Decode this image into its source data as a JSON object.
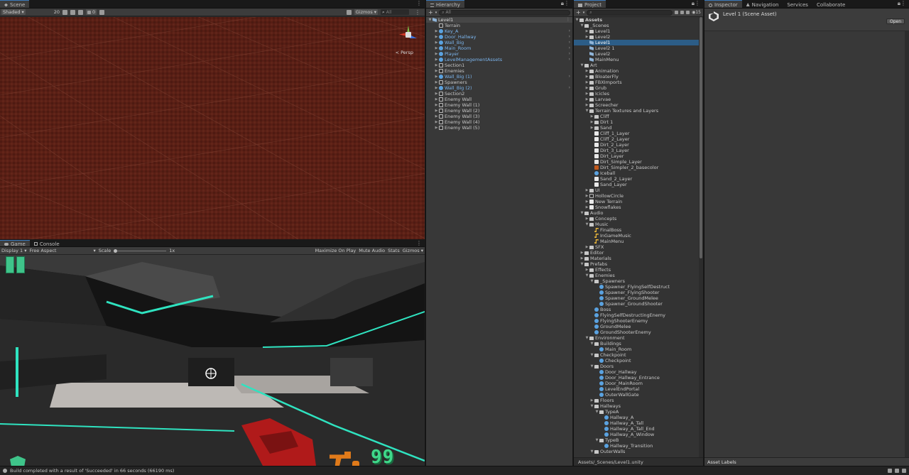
{
  "scene": {
    "tab": "Scene",
    "shading": "Shaded",
    "grid_size": "20",
    "layers_count": "0",
    "gizmos": "Gizmos",
    "search": "All",
    "persp": "< Persp"
  },
  "game": {
    "tabs": [
      "Game",
      "Console"
    ],
    "display": "Display 1",
    "aspect": "Free Aspect",
    "scale_label": "Scale",
    "scale_value": "1x",
    "maximize": "Maximize On Play",
    "mute": "Mute Audio",
    "stats": "Stats",
    "gizmos": "Gizmos",
    "ammo": "99"
  },
  "hierarchy": {
    "tab": "Hierarchy",
    "search": "All",
    "items": [
      {
        "label": "Level1",
        "depth": 0,
        "icon": "scene",
        "root": true,
        "expanded": true
      },
      {
        "label": "Terrain",
        "depth": 1,
        "icon": "cube"
      },
      {
        "label": "Key_A",
        "depth": 1,
        "icon": "prefab",
        "blue": true,
        "arrow": true,
        "chev": true
      },
      {
        "label": "Door_Hallway",
        "depth": 1,
        "icon": "prefab",
        "blue": true,
        "arrow": true,
        "chev": true
      },
      {
        "label": "Wall_Big",
        "depth": 1,
        "icon": "prefab",
        "blue": true,
        "arrow": true,
        "chev": true
      },
      {
        "label": "Main_Room",
        "depth": 1,
        "icon": "prefab",
        "blue": true,
        "arrow": true,
        "chev": true
      },
      {
        "label": "Player",
        "depth": 1,
        "icon": "prefab",
        "blue": true,
        "arrow": true,
        "chev": true
      },
      {
        "label": "LevelManagementAssets",
        "depth": 1,
        "icon": "prefab",
        "blue": true,
        "arrow": true,
        "chev": true
      },
      {
        "label": "Section1",
        "depth": 1,
        "icon": "cube",
        "arrow": true
      },
      {
        "label": "Enemies",
        "depth": 1,
        "icon": "cube",
        "arrow": true
      },
      {
        "label": "Wall_Big (1)",
        "depth": 1,
        "icon": "prefab",
        "blue": true,
        "arrow": true,
        "chev": true
      },
      {
        "label": "Spawners",
        "depth": 1,
        "icon": "cube",
        "arrow": true
      },
      {
        "label": "Wall_Big (2)",
        "depth": 1,
        "icon": "prefab",
        "blue": true,
        "arrow": true,
        "chev": true
      },
      {
        "label": "Section2",
        "depth": 1,
        "icon": "cube",
        "arrow": true
      },
      {
        "label": "Enemy Wall",
        "depth": 1,
        "icon": "cube",
        "arrow": true
      },
      {
        "label": "Enemy Wall (1)",
        "depth": 1,
        "icon": "cube",
        "arrow": true
      },
      {
        "label": "Enemy Wall (2)",
        "depth": 1,
        "icon": "cube",
        "arrow": true
      },
      {
        "label": "Enemy Wall (3)",
        "depth": 1,
        "icon": "cube",
        "arrow": true
      },
      {
        "label": "Enemy Wall (4)",
        "depth": 1,
        "icon": "cube",
        "arrow": true
      },
      {
        "label": "Enemy Wall (5)",
        "depth": 1,
        "icon": "cube",
        "arrow": true
      }
    ]
  },
  "project": {
    "tab": "Project",
    "count": "15",
    "path": "Assets/_Scenes/Level1.unity",
    "items": [
      {
        "label": "Assets",
        "depth": 0,
        "icon": "folder",
        "exp": true,
        "bold": true
      },
      {
        "label": "_Scenes",
        "depth": 1,
        "icon": "folder",
        "exp": true
      },
      {
        "label": "Level1",
        "depth": 2,
        "icon": "folder",
        "col": true
      },
      {
        "label": "Level2",
        "depth": 2,
        "icon": "folder",
        "col": true
      },
      {
        "label": "Level1",
        "depth": 2,
        "icon": "scene",
        "sel": true
      },
      {
        "label": "Level2 1",
        "depth": 2,
        "icon": "scene"
      },
      {
        "label": "Level2",
        "depth": 2,
        "icon": "scene"
      },
      {
        "label": "MainMenu",
        "depth": 2,
        "icon": "scene"
      },
      {
        "label": "Art",
        "depth": 1,
        "icon": "folder",
        "exp": true
      },
      {
        "label": "Animation",
        "depth": 2,
        "icon": "folder",
        "col": true
      },
      {
        "label": "BloaterFly",
        "depth": 2,
        "icon": "folder",
        "col": true
      },
      {
        "label": "FBXImports",
        "depth": 2,
        "icon": "folder",
        "col": true
      },
      {
        "label": "Grub",
        "depth": 2,
        "icon": "folder",
        "col": true
      },
      {
        "label": "Icicles",
        "depth": 2,
        "icon": "folder",
        "col": true
      },
      {
        "label": "Larvae",
        "depth": 2,
        "icon": "folder",
        "col": true
      },
      {
        "label": "Screecher",
        "depth": 2,
        "icon": "folder",
        "col": true
      },
      {
        "label": "Terrain Textures and Layers",
        "depth": 2,
        "icon": "folder",
        "exp": true
      },
      {
        "label": "Cliff",
        "depth": 3,
        "icon": "folder",
        "col": true
      },
      {
        "label": "Dirt 1",
        "depth": 3,
        "icon": "folder",
        "col": true
      },
      {
        "label": "Sand",
        "depth": 3,
        "icon": "folder",
        "col": true
      },
      {
        "label": "Cliff_1_Layer",
        "depth": 3,
        "icon": "tex"
      },
      {
        "label": "Cliff_2_Layer",
        "depth": 3,
        "icon": "tex"
      },
      {
        "label": "Dirt_2_Layer",
        "depth": 3,
        "icon": "tex"
      },
      {
        "label": "Dirt_3_Layer",
        "depth": 3,
        "icon": "tex"
      },
      {
        "label": "Dirt_Layer",
        "depth": 3,
        "icon": "tex"
      },
      {
        "label": "Dirt_Simple_Layer",
        "depth": 3,
        "icon": "tex"
      },
      {
        "label": "Dirt_Simpler_2_basecolor",
        "depth": 3,
        "icon": "color"
      },
      {
        "label": "Iceball",
        "depth": 3,
        "icon": "prefab"
      },
      {
        "label": "Sand_2_Layer",
        "depth": 3,
        "icon": "tex"
      },
      {
        "label": "Sand_Layer",
        "depth": 3,
        "icon": "tex"
      },
      {
        "label": "UI",
        "depth": 2,
        "icon": "folder",
        "col": true
      },
      {
        "label": "HollowCircle",
        "depth": 2,
        "icon": "cube",
        "col": true
      },
      {
        "label": "New Terrain",
        "depth": 2,
        "icon": "tex",
        "col": true
      },
      {
        "label": "Snowflakes",
        "depth": 2,
        "icon": "tex",
        "col": true
      },
      {
        "label": "Audio",
        "depth": 1,
        "icon": "folder",
        "exp": true
      },
      {
        "label": "Concepts",
        "depth": 2,
        "icon": "folder",
        "col": true
      },
      {
        "label": "Music",
        "depth": 2,
        "icon": "folder",
        "exp": true
      },
      {
        "label": "FinalBoss",
        "depth": 3,
        "icon": "music"
      },
      {
        "label": "InGameMusic",
        "depth": 3,
        "icon": "music"
      },
      {
        "label": "MainMenu",
        "depth": 3,
        "icon": "music"
      },
      {
        "label": "SFX",
        "depth": 2,
        "icon": "folder",
        "col": true
      },
      {
        "label": "Editor",
        "depth": 1,
        "icon": "folder",
        "col": true
      },
      {
        "label": "Materials",
        "depth": 1,
        "icon": "folder",
        "col": true
      },
      {
        "label": "Prefabs",
        "depth": 1,
        "icon": "folder",
        "exp": true
      },
      {
        "label": "Effects",
        "depth": 2,
        "icon": "folder",
        "col": true
      },
      {
        "label": "Enemies",
        "depth": 2,
        "icon": "folder",
        "exp": true
      },
      {
        "label": "_Spawners",
        "depth": 3,
        "icon": "folder",
        "exp": true
      },
      {
        "label": "Spawner_FlyingSelfDestruct",
        "depth": 4,
        "icon": "prefab"
      },
      {
        "label": "Spawner_FlyingShooter",
        "depth": 4,
        "icon": "prefab"
      },
      {
        "label": "Spawner_GroundMelee",
        "depth": 4,
        "icon": "prefab"
      },
      {
        "label": "Spawner_GroundShooter",
        "depth": 4,
        "icon": "prefab"
      },
      {
        "label": "Boss",
        "depth": 3,
        "icon": "prefab"
      },
      {
        "label": "FlyingSelfDestructingEnemy",
        "depth": 3,
        "icon": "prefab"
      },
      {
        "label": "FlyingShooterEnemy",
        "depth": 3,
        "icon": "prefab"
      },
      {
        "label": "GroundMelee",
        "depth": 3,
        "icon": "prefab"
      },
      {
        "label": "GroundShooterEnemy",
        "depth": 3,
        "icon": "prefab"
      },
      {
        "label": "Environment",
        "depth": 2,
        "icon": "folder",
        "exp": true
      },
      {
        "label": "Buildings",
        "depth": 3,
        "icon": "folder",
        "exp": true
      },
      {
        "label": "Main_Room",
        "depth": 4,
        "icon": "prefab"
      },
      {
        "label": "Checkpoint",
        "depth": 3,
        "icon": "folder",
        "exp": true
      },
      {
        "label": "Checkpoint",
        "depth": 4,
        "icon": "prefab"
      },
      {
        "label": "Doors",
        "depth": 3,
        "icon": "folder",
        "exp": true
      },
      {
        "label": "Door_Hallway",
        "depth": 4,
        "icon": "prefab"
      },
      {
        "label": "Door_Hallway_Entrance",
        "depth": 4,
        "icon": "prefab"
      },
      {
        "label": "Door_MainRoom",
        "depth": 4,
        "icon": "prefab"
      },
      {
        "label": "LevelEndPortal",
        "depth": 4,
        "icon": "prefab"
      },
      {
        "label": "OuterWallGate",
        "depth": 4,
        "icon": "prefab"
      },
      {
        "label": "Floors",
        "depth": 3,
        "icon": "folder",
        "col": true
      },
      {
        "label": "Hallways",
        "depth": 3,
        "icon": "folder",
        "exp": true
      },
      {
        "label": "TypeA",
        "depth": 4,
        "icon": "folder",
        "exp": true
      },
      {
        "label": "Hallway_A",
        "depth": 5,
        "icon": "prefab"
      },
      {
        "label": "Hallway_A_Tall",
        "depth": 5,
        "icon": "prefab"
      },
      {
        "label": "Hallway_A_Tall_End",
        "depth": 5,
        "icon": "prefab"
      },
      {
        "label": "Hallway_A_Window",
        "depth": 5,
        "icon": "prefab"
      },
      {
        "label": "TypeB",
        "depth": 4,
        "icon": "folder",
        "exp": true
      },
      {
        "label": "Hallway_Transition",
        "depth": 5,
        "icon": "prefab"
      },
      {
        "label": "OuterWalls",
        "depth": 3,
        "icon": "folder",
        "exp": true
      }
    ]
  },
  "inspector": {
    "tabs": [
      "Inspector",
      "Navigation",
      "Services",
      "Collaborate"
    ],
    "asset_title": "Level 1 (Scene Asset)",
    "open_button": "Open",
    "asset_labels": "Asset Labels"
  },
  "status": {
    "message": "Build completed with a result of 'Succeeded' in 66 seconds (66190 ms)"
  }
}
